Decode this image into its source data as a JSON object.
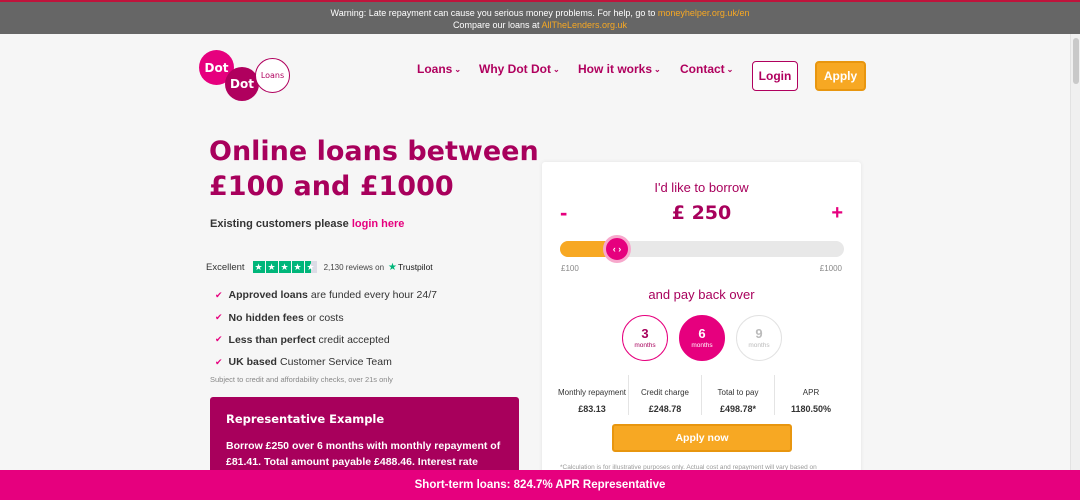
{
  "warning": {
    "line1_prefix": "Warning: Late repayment can cause you serious money problems. For help, go to ",
    "line1_link": "moneyhelper.org.uk/en",
    "line2_prefix": "Compare our loans at ",
    "line2_link": "AllTheLenders.org.uk"
  },
  "logo": {
    "word1": "Dot",
    "word2": "Dot",
    "word3": "Loans"
  },
  "nav": {
    "items": [
      {
        "label": "Loans",
        "icon": "chevron-down-icon"
      },
      {
        "label": "Why Dot Dot",
        "icon": "chevron-down-icon"
      },
      {
        "label": "How it works",
        "icon": "chevron-down-icon"
      },
      {
        "label": "Contact",
        "icon": "chevron-down-icon"
      }
    ],
    "login_label": "Login",
    "apply_label": "Apply"
  },
  "hero": {
    "title": "Online loans between £100 and £1000",
    "existing_prefix": "Existing customers please ",
    "existing_link": "login here"
  },
  "trustpilot": {
    "rating_word": "Excellent",
    "stars": 4.5,
    "reviews": "2,130 reviews on",
    "brand": "Trustpilot"
  },
  "features": [
    {
      "bold": "Approved loans",
      "rest": "are funded every hour 24/7"
    },
    {
      "bold": "No hidden fees",
      "rest": "or costs"
    },
    {
      "bold": "Less than perfect",
      "rest": "credit accepted"
    },
    {
      "bold": "UK based",
      "rest": "Customer Service Team"
    }
  ],
  "subject_note": "Subject to credit and affordability checks, over 21s only",
  "representative": {
    "title": "Representative Example",
    "text": "Borrow £250 over 6 months with monthly repayment of £81.41. Total amount payable £488.46. Interest rate"
  },
  "calculator": {
    "borrow_label": "I'd like to borrow",
    "minus": "-",
    "plus": "+",
    "amount": "£ 250",
    "slider_value": 250,
    "slider_min_value": 100,
    "slider_max_value": 1000,
    "slider_handle": "‹ ›",
    "slider_min_label": "£100",
    "slider_max_label": "£1000",
    "payback_label": "and pay back over",
    "terms": [
      {
        "num": "3",
        "unit": "months",
        "state": "default"
      },
      {
        "num": "6",
        "unit": "months",
        "state": "selected"
      },
      {
        "num": "9",
        "unit": "months",
        "state": "disabled"
      }
    ],
    "summary": [
      {
        "label": "Monthly repayment",
        "value": "£83.13"
      },
      {
        "label": "Credit charge",
        "value": "£248.78"
      },
      {
        "label": "Total to pay",
        "value": "£498.78*"
      },
      {
        "label": "APR",
        "value": "1180.50%"
      }
    ],
    "apply_label": "Apply now",
    "note": "*Calculation is for illustrative purposes only. Actual cost and repayment will vary based on"
  },
  "bottom_bar": "Short-term loans: 824.7% APR Representative",
  "colors": {
    "brand_pink": "#e6007e",
    "brand_magenta": "#a8005c",
    "accent_orange": "#f7a823",
    "warning_bg": "#666666",
    "trustpilot_green": "#00b67a"
  }
}
